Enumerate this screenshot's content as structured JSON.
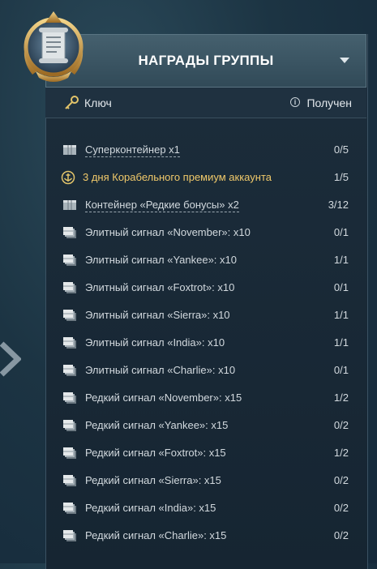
{
  "header": {
    "title": "НАГРАДЫ ГРУППЫ"
  },
  "keybar": {
    "key_label": "Ключ",
    "received_label": "Получен",
    "received_icon_glyph": "i"
  },
  "rewards": [
    {
      "icon": "container-icon",
      "name": "Суперконтейнер x1",
      "count": "0/5",
      "style": "dotted"
    },
    {
      "icon": "premium-anchor-icon",
      "name": "3 дня Корабельного премиум аккаунта",
      "count": "1/5",
      "style": "gold"
    },
    {
      "icon": "container-icon",
      "name": "Контейнер «Редкие бонусы» x2",
      "count": "3/12",
      "style": "dotted"
    },
    {
      "icon": "signal-flag-icon",
      "name": "Элитный сигнал «November»: x10",
      "count": "0/1",
      "style": "plain"
    },
    {
      "icon": "signal-flag-icon",
      "name": "Элитный сигнал «Yankee»: x10",
      "count": "1/1",
      "style": "plain"
    },
    {
      "icon": "signal-flag-icon",
      "name": "Элитный сигнал «Foxtrot»: x10",
      "count": "0/1",
      "style": "plain"
    },
    {
      "icon": "signal-flag-icon",
      "name": "Элитный сигнал «Sierra»: x10",
      "count": "1/1",
      "style": "plain"
    },
    {
      "icon": "signal-flag-icon",
      "name": "Элитный сигнал «India»: x10",
      "count": "1/1",
      "style": "plain"
    },
    {
      "icon": "signal-flag-icon",
      "name": "Элитный сигнал «Charlie»: x10",
      "count": "0/1",
      "style": "plain"
    },
    {
      "icon": "signal-flag-icon",
      "name": "Редкий сигнал «November»: x15",
      "count": "1/2",
      "style": "plain"
    },
    {
      "icon": "signal-flag-icon",
      "name": "Редкий сигнал «Yankee»: x15",
      "count": "0/2",
      "style": "plain"
    },
    {
      "icon": "signal-flag-icon",
      "name": "Редкий сигнал «Foxtrot»: x15",
      "count": "1/2",
      "style": "plain"
    },
    {
      "icon": "signal-flag-icon",
      "name": "Редкий сигнал «Sierra»: x15",
      "count": "0/2",
      "style": "plain"
    },
    {
      "icon": "signal-flag-icon",
      "name": "Редкий сигнал «India»: x15",
      "count": "0/2",
      "style": "plain"
    },
    {
      "icon": "signal-flag-icon",
      "name": "Редкий сигнал «Charlie»: x15",
      "count": "0/2",
      "style": "plain"
    }
  ],
  "colors": {
    "accent_gold": "#f0c96a",
    "text": "#d2d9de",
    "header_bg": "#3d5664"
  }
}
